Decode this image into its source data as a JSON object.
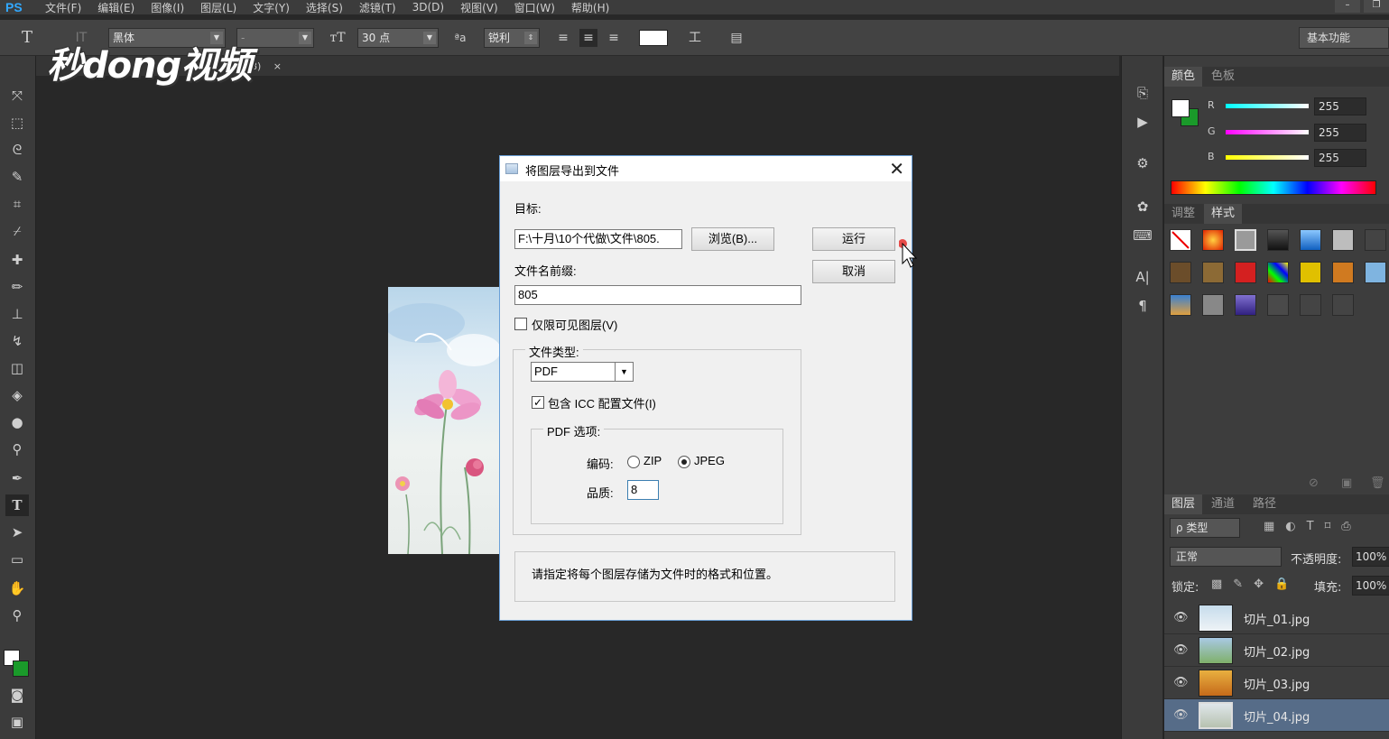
{
  "app": {
    "logo": "PS",
    "menu": [
      "文件(F)",
      "编辑(E)",
      "图像(I)",
      "图层(L)",
      "文字(Y)",
      "选择(S)",
      "滤镜(T)",
      "3D(D)",
      "视图(V)",
      "窗口(W)",
      "帮助(H)"
    ]
  },
  "options": {
    "font_family": "黑体",
    "font_style": "-",
    "font_size": "30 点",
    "antialias_label": "ªa",
    "antialias": "锐利",
    "workspace": "基本功能"
  },
  "watermark": "秒dong视频",
  "document": {
    "tab_suffix": "8)",
    "tab_close": "×"
  },
  "dialog": {
    "title": "将图层导出到文件",
    "close": "✕",
    "target_label": "目标:",
    "target_value": "F:\\十月\\10个代做\\文件\\805.",
    "browse": "浏览(B)...",
    "run": "运行",
    "cancel": "取消",
    "prefix_label": "文件名前缀:",
    "prefix_value": "805",
    "visible_only_label": "仅限可见图层(V)",
    "visible_only": false,
    "file_type_group": "文件类型:",
    "file_type": "PDF",
    "include_icc_label": "包含 ICC 配置文件(I)",
    "include_icc": true,
    "pdf_options_group": "PDF 选项:",
    "encoding_label": "编码:",
    "encoding_zip": "ZIP",
    "encoding_jpeg": "JPEG",
    "encoding_selected": "JPEG",
    "quality_label": "品质:",
    "quality_value": "8",
    "hint": "请指定将每个图层存储为文件时的格式和位置。"
  },
  "color_panel": {
    "tabs": [
      "颜色",
      "色板"
    ],
    "channels": [
      {
        "label": "R",
        "value": "255"
      },
      {
        "label": "G",
        "value": "255"
      },
      {
        "label": "B",
        "value": "255"
      }
    ]
  },
  "styles_panel": {
    "tabs": [
      "调整",
      "样式"
    ]
  },
  "layers_panel": {
    "tabs": [
      "图层",
      "通道",
      "路径"
    ],
    "filter": "ρ 类型",
    "blend_mode": "正常",
    "opacity_label": "不透明度:",
    "opacity": "100%",
    "lock_label": "锁定:",
    "fill_label": "填充:",
    "fill": "100%",
    "layers": [
      {
        "name": "切片_01.jpg",
        "selected": false
      },
      {
        "name": "切片_02.jpg",
        "selected": false
      },
      {
        "name": "切片_03.jpg",
        "selected": false
      },
      {
        "name": "切片_04.jpg",
        "selected": true
      }
    ]
  },
  "colors": {
    "accent": "#31a8ff",
    "selection": "#566c88"
  }
}
